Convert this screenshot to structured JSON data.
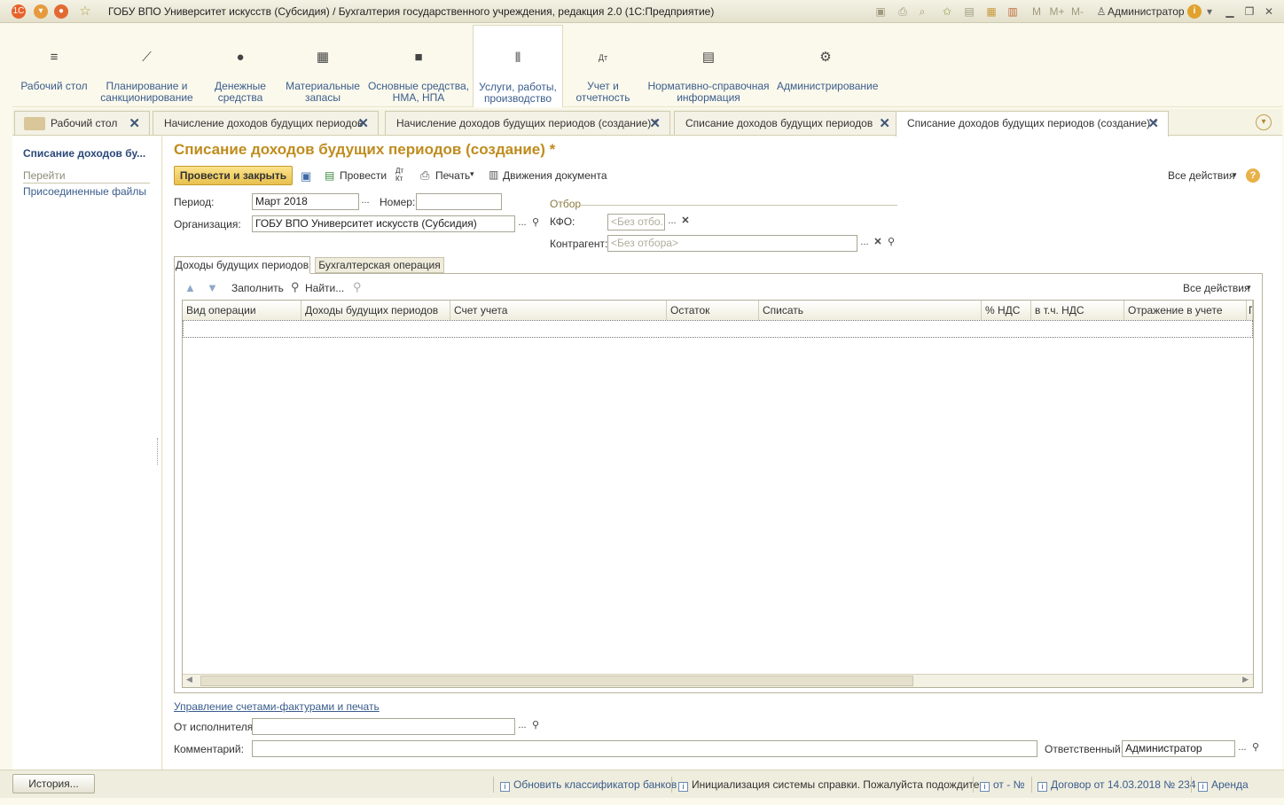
{
  "window": {
    "title": "ГОБУ ВПО Университет искусств (Субсидия) / Бухгалтерия государственного учреждения, редакция 2.0  (1С:Предприятие)",
    "user": "Администратор",
    "m": "M",
    "mplus": "M+",
    "mminus": "M-"
  },
  "sections": [
    {
      "label": "Рабочий стол",
      "icon": "menu-icon"
    },
    {
      "label": "Планирование и санкционирование",
      "icon": "chart-icon"
    },
    {
      "label": "Денежные средства",
      "icon": "ruble-icon"
    },
    {
      "label": "Материальные запасы",
      "icon": "grid-icon"
    },
    {
      "label": "Основные средства, НМА, НПА",
      "icon": "truck-icon"
    },
    {
      "label": "Услуги, работы, производство",
      "icon": "tools-icon"
    },
    {
      "label": "Учет и отчетность",
      "icon": "dt-kt-icon"
    },
    {
      "label": "Нормативно-справочная информация",
      "icon": "book-icon"
    },
    {
      "label": "Администрирование",
      "icon": "gear-icon"
    }
  ],
  "open_tabs": [
    {
      "label": "Рабочий стол"
    },
    {
      "label": "Начисление доходов будущих периодов"
    },
    {
      "label": "Начисление доходов будущих периодов (создание) *"
    },
    {
      "label": "Списание доходов будущих периодов"
    },
    {
      "label": "Списание доходов будущих периодов (создание) *"
    }
  ],
  "left_panel": {
    "title": "Списание доходов бу...",
    "goto": "Перейти",
    "link": "Присоединенные файлы"
  },
  "form": {
    "title": "Списание доходов будущих периодов (создание) *",
    "toolbar": {
      "post_close": "Провести и закрыть",
      "post": "Провести",
      "print": "Печать",
      "movements": "Движения документа",
      "all_actions": "Все действия",
      "dtkt": "Дт Кт"
    },
    "period_label": "Период:",
    "period_value": "Март 2018",
    "number_label": "Номер:",
    "number_value": "",
    "org_label": "Организация:",
    "org_value": "ГОБУ ВПО Университет искусств (Субсидия)",
    "filter_title": "Отбор",
    "kfo_label": "КФО:",
    "kfo_placeholder": "<Без отбо...",
    "contractor_label": "Контрагент:",
    "contractor_placeholder": "<Без отбора>",
    "tabs": [
      "Доходы будущих периодов",
      "Бухгалтерская операция"
    ],
    "table_toolbar": {
      "fill": "Заполнить",
      "find": "Найти...",
      "all_actions": "Все действия"
    },
    "columns": [
      "Вид операции",
      "Доходы будущих периодов",
      "Счет учета",
      "Остаток",
      "Списать",
      "% НДС",
      "в т.ч. НДС",
      "Отражение в учете",
      "П"
    ],
    "invoice_link": "Управление счетами-фактурами и печать",
    "executor_label": "От исполнителя:",
    "executor_value": "",
    "comment_label": "Комментарий:",
    "comment_value": "",
    "responsible_label": "Ответственный:",
    "responsible_value": "Администратор"
  },
  "status": {
    "history": "История...",
    "messages": [
      "Обновить классификатор банков",
      "Инициализация системы справки. Пожалуйста подождите...",
      "от - №",
      "Договор от 14.03.2018 № 234",
      "Аренда"
    ]
  }
}
